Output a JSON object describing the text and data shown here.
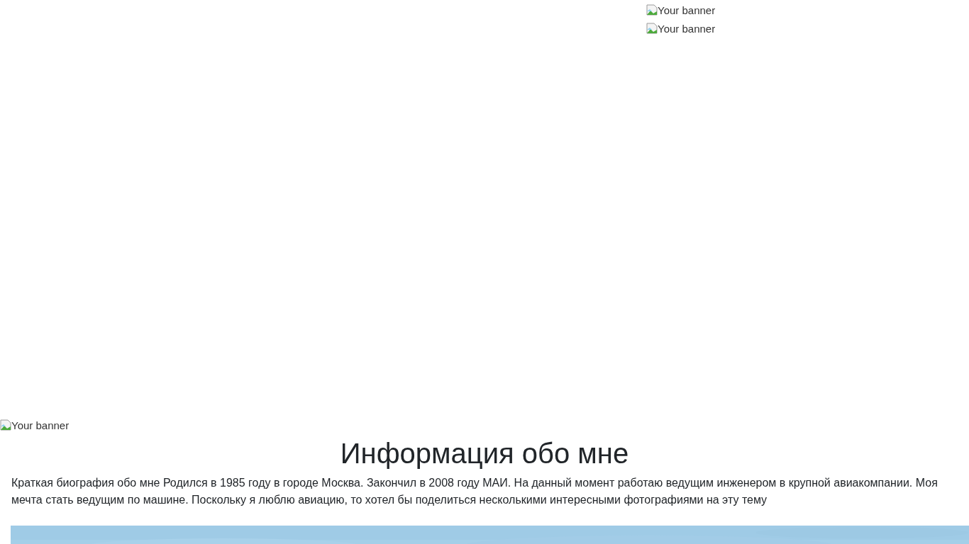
{
  "top_banners": [
    {
      "alt": "Your banner"
    },
    {
      "alt": "Your banner"
    }
  ],
  "side_banner": {
    "alt": "Your banner"
  },
  "heading": "Информация обо мне",
  "bio": "Краткая биография обо мне Родился в 1985 году в городе Москва. Закончил в 2008 году МАИ. На данный момент работаю ведущим инженером в крупной авиакомпании. Моя мечта стать ведущим по машине. Поскольку я люблю авиацию, то хотел бы поделиться несколькими интересными фотографиями на эту тему"
}
